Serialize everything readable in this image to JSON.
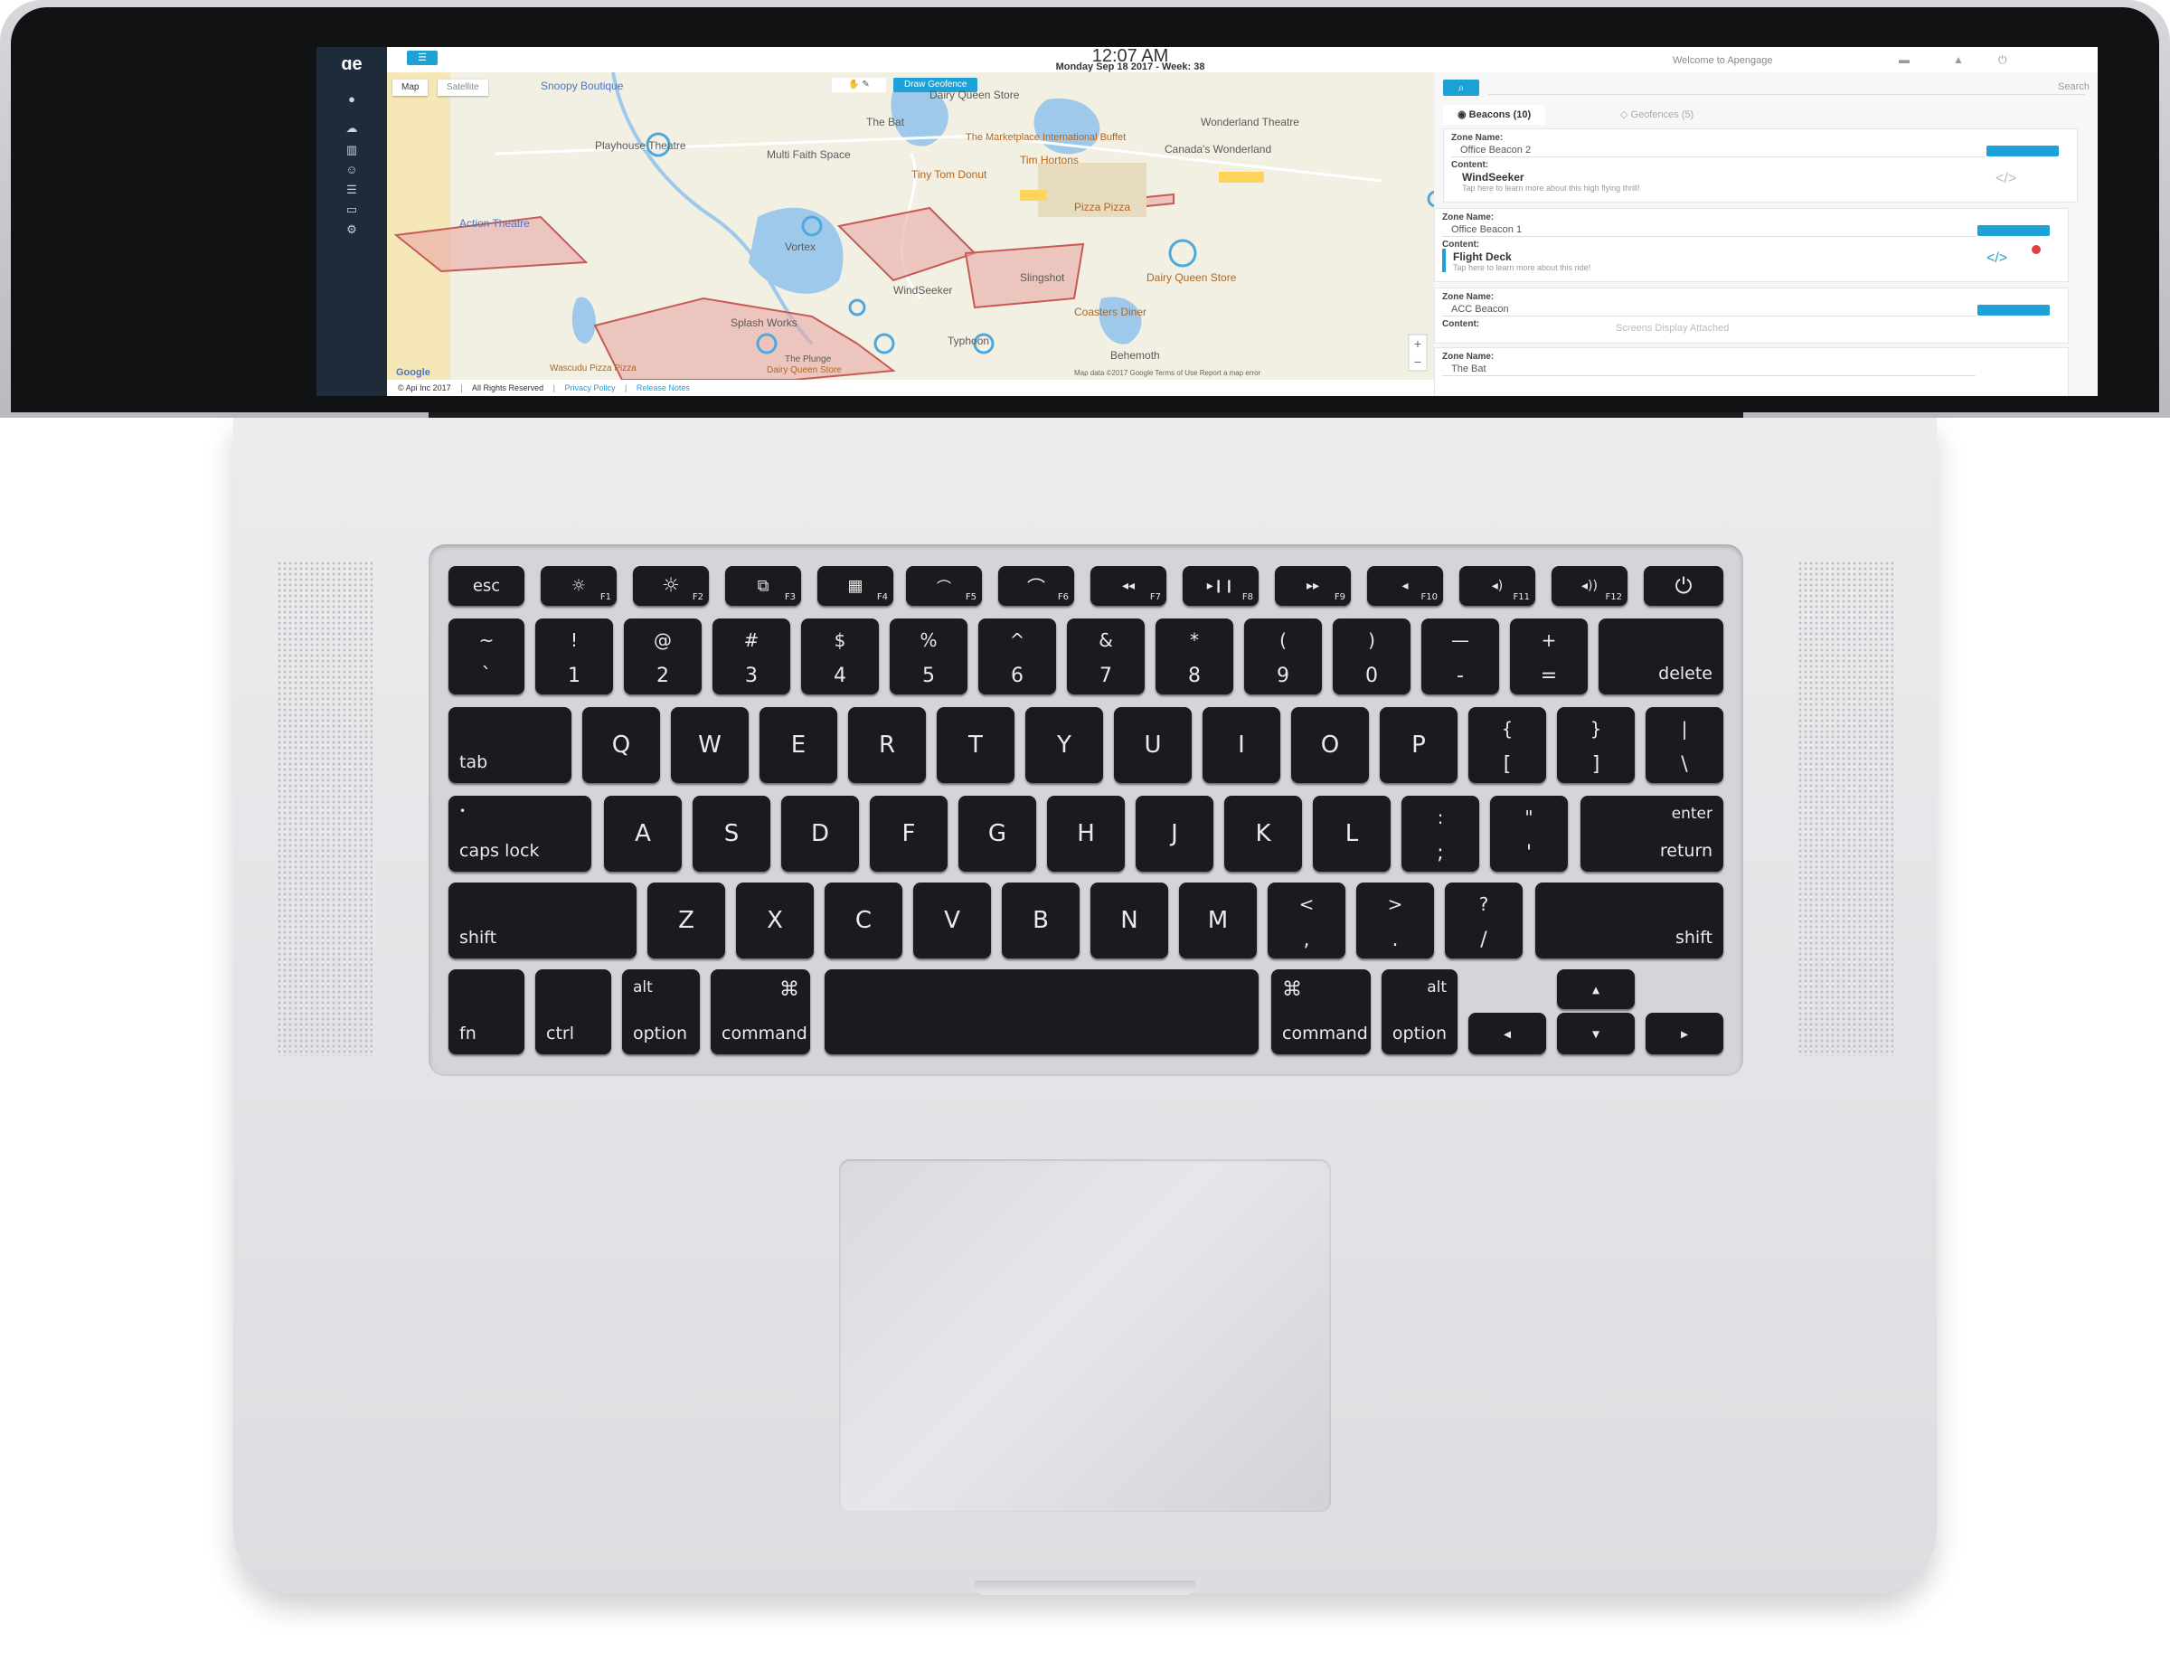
{
  "screen": {
    "clock": "12:07 AM",
    "date": "Monday Sep 18 2017 - Week: 38",
    "welcome": "Welcome to Apengage",
    "map_tabs": [
      "Map",
      "Satellite"
    ],
    "draw_geofence": "Draw Geofence",
    "map_labels": [
      {
        "text": "Snoopy Boutique",
        "style": "blue"
      },
      {
        "text": "Dairy Queen Store",
        "style": "plain"
      },
      {
        "text": "The Bat",
        "style": "plain"
      },
      {
        "text": "Wonderland Theatre",
        "style": "plain"
      },
      {
        "text": "Playhouse Theatre",
        "style": "plain"
      },
      {
        "text": "Multi Faith Space",
        "style": "plain"
      },
      {
        "text": "The Marketplace International Buffet",
        "style": "orange"
      },
      {
        "text": "Tim Hortons",
        "style": "orange"
      },
      {
        "text": "Canada's Wonderland",
        "style": "plain"
      },
      {
        "text": "Tiny Tom Donut",
        "style": "orange"
      },
      {
        "text": "Action Theatre",
        "style": "blue"
      },
      {
        "text": "Vortex",
        "style": "plain"
      },
      {
        "text": "Pizza Pizza",
        "style": "orange"
      },
      {
        "text": "Slingshot",
        "style": "plain"
      },
      {
        "text": "Dairy Queen Store",
        "style": "orange"
      },
      {
        "text": "WindSeeker",
        "style": "plain"
      },
      {
        "text": "Coasters Diner",
        "style": "orange"
      },
      {
        "text": "Splash Works",
        "style": "plain"
      },
      {
        "text": "Typhoon",
        "style": "plain"
      },
      {
        "text": "Behemoth",
        "style": "plain"
      },
      {
        "text": "Wascudu Pizza Pizza",
        "style": "orange"
      },
      {
        "text": "The Plunge",
        "style": "plain"
      },
      {
        "text": "Dairy Queen Store",
        "style": "orange"
      }
    ],
    "google": "Google",
    "map_footer_right": "Map data ©2017 Google   Terms of Use   Report a map error",
    "footer": {
      "copyright": "© Api Inc 2017",
      "rights": "All Rights Reserved",
      "privacy": "Privacy Policy",
      "release": "Release Notes"
    },
    "panel": {
      "search_placeholder": "Search",
      "tabs": [
        "Beacons (10)",
        "Geofences (5)"
      ],
      "zone_label": "Zone Name:",
      "content_label": "Content:",
      "zones": [
        {
          "name": "Office Beacon 2",
          "content_title": "WindSeeker",
          "content_sub": "Tap here to learn more about this high flying thrill!"
        },
        {
          "name": "Office Beacon 1",
          "content_title": "Flight Deck",
          "content_sub": "Tap here to learn more about this ride!"
        },
        {
          "name": "ACC Beacon",
          "content_title": "Screens Display Attached",
          "content_sub": ""
        },
        {
          "name": "The Bat",
          "content_title": "",
          "content_sub": ""
        }
      ]
    }
  },
  "keyboard": {
    "fn_row": [
      {
        "main": "esc",
        "fn": ""
      },
      {
        "main": "☼",
        "fn": "F1"
      },
      {
        "main": "☼",
        "fn": "F2"
      },
      {
        "main": "⧉",
        "fn": "F3"
      },
      {
        "main": "▦",
        "fn": "F4"
      },
      {
        "main": "⌒",
        "fn": "F5"
      },
      {
        "main": "⌒",
        "fn": "F6"
      },
      {
        "main": "◂◂",
        "fn": "F7"
      },
      {
        "main": "▸❙❙",
        "fn": "F8"
      },
      {
        "main": "▸▸",
        "fn": "F9"
      },
      {
        "main": "◂",
        "fn": "F10"
      },
      {
        "main": "◂)",
        "fn": "F11"
      },
      {
        "main": "◂))",
        "fn": "F12"
      },
      {
        "main": "⏻",
        "fn": ""
      }
    ],
    "num_row": [
      {
        "top": "~",
        "bottom": "`"
      },
      {
        "top": "!",
        "bottom": "1"
      },
      {
        "top": "@",
        "bottom": "2"
      },
      {
        "top": "#",
        "bottom": "3"
      },
      {
        "top": "$",
        "bottom": "4"
      },
      {
        "top": "%",
        "bottom": "5"
      },
      {
        "top": "^",
        "bottom": "6"
      },
      {
        "top": "&",
        "bottom": "7"
      },
      {
        "top": "*",
        "bottom": "8"
      },
      {
        "top": "(",
        "bottom": "9"
      },
      {
        "top": ")",
        "bottom": "0"
      },
      {
        "top": "—",
        "bottom": "-"
      },
      {
        "top": "+",
        "bottom": "="
      }
    ],
    "delete": "delete",
    "tab": "tab",
    "q_row": [
      "Q",
      "W",
      "E",
      "R",
      "T",
      "Y",
      "U",
      "I",
      "O",
      "P"
    ],
    "q_row_brackets": [
      {
        "top": "{",
        "bottom": "["
      },
      {
        "top": "}",
        "bottom": "]"
      },
      {
        "top": "|",
        "bottom": "\\"
      }
    ],
    "caps": "caps lock",
    "a_row": [
      "A",
      "S",
      "D",
      "F",
      "G",
      "H",
      "J",
      "K",
      "L"
    ],
    "a_row_punct": [
      {
        "top": ":",
        "bottom": ";"
      },
      {
        "top": "\"",
        "bottom": "'"
      }
    ],
    "enter": "enter",
    "return": "return",
    "shift": "shift",
    "z_row": [
      "Z",
      "X",
      "C",
      "V",
      "B",
      "N",
      "M"
    ],
    "z_row_punct": [
      {
        "top": "<",
        "bottom": ","
      },
      {
        "top": ">",
        "bottom": "."
      },
      {
        "top": "?",
        "bottom": "/"
      }
    ],
    "fn": "fn",
    "ctrl": "ctrl",
    "alt": "alt",
    "option": "option",
    "cmd_symbol": "⌘",
    "command": "command",
    "arrows": {
      "left": "◂",
      "up": "▴",
      "down": "▾",
      "right": "▸"
    }
  }
}
